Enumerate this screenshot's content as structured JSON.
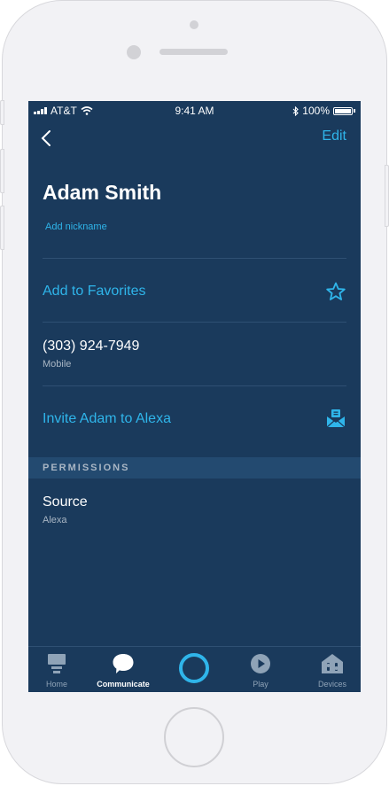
{
  "status": {
    "carrier": "AT&T",
    "time": "9:41 AM",
    "battery": "100%"
  },
  "header": {
    "edit_label": "Edit"
  },
  "contact": {
    "name": "Adam Smith",
    "nickname_link": "Add nickname",
    "favorites_label": "Add to Favorites",
    "phone_number": "(303) 924-7949",
    "phone_type": "Mobile",
    "invite_label": "Invite Adam to Alexa"
  },
  "permissions": {
    "header": "PERMISSIONS",
    "source_title": "Source",
    "source_value": "Alexa"
  },
  "tabbar": {
    "tabs": [
      {
        "label": "Home",
        "icon": "home-icon",
        "active": false
      },
      {
        "label": "Communicate",
        "icon": "chat-bubble-icon",
        "active": true
      },
      {
        "label": "",
        "icon": "alexa-ring-icon",
        "active": false
      },
      {
        "label": "Play",
        "icon": "play-icon",
        "active": false
      },
      {
        "label": "Devices",
        "icon": "devices-icon",
        "active": false
      }
    ]
  },
  "colors": {
    "accent": "#2fb5ea",
    "background": "#1a3a5c",
    "section_header": "#234a70"
  }
}
